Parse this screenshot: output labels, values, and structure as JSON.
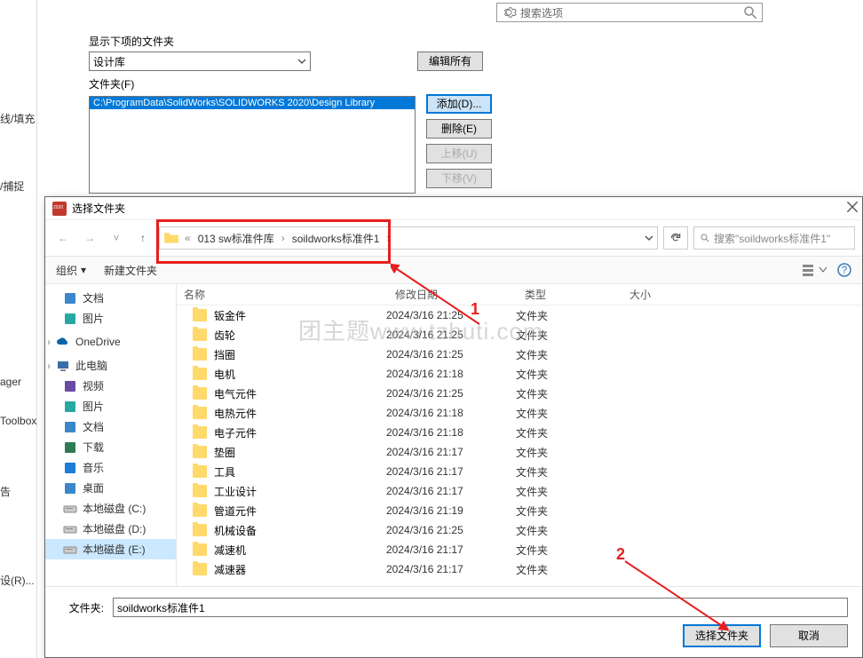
{
  "top_search": {
    "placeholder": "搜索选项"
  },
  "options": {
    "display_label": "显示下项的文件夹",
    "combo_value": "设计库",
    "edit_all": "编辑所有",
    "folders_label": "文件夹(F)",
    "add": "添加(D)...",
    "delete": "删除(E)",
    "move_up": "上移(U)",
    "move_down": "下移(V)",
    "path": "C:\\ProgramData\\SolidWorks\\SOLIDWORKS 2020\\Design Library"
  },
  "left_labels": {
    "l1": "线/填充",
    "l2": "ager",
    "l3": "/捕捉",
    "l4": "Toolbox",
    "l5": "告",
    "l6": "设(R)...",
    "l7": "OneDrive"
  },
  "dialog": {
    "title": "选择文件夹",
    "breadcrumb": {
      "sep_prefix": "«",
      "item1": "013 sw标准件库",
      "item2": "soildworks标准件1"
    },
    "search_placeholder": "搜索\"soildworks标准件1\"",
    "organize": "组织",
    "new_folder": "新建文件夹",
    "cols": {
      "name": "名称",
      "date": "修改日期",
      "type": "类型",
      "size": "大小"
    },
    "tree": [
      {
        "label": "文档",
        "kind": "doc"
      },
      {
        "label": "图片",
        "kind": "pic"
      },
      {
        "label": "OneDrive",
        "kind": "onedrive",
        "l0": true
      },
      {
        "label": "此电脑",
        "kind": "pc",
        "l0": true
      },
      {
        "label": "视频",
        "kind": "video"
      },
      {
        "label": "图片",
        "kind": "pic"
      },
      {
        "label": "文档",
        "kind": "doc"
      },
      {
        "label": "下载",
        "kind": "dl"
      },
      {
        "label": "音乐",
        "kind": "music"
      },
      {
        "label": "桌面",
        "kind": "desk"
      },
      {
        "label": "本地磁盘 (C:)",
        "kind": "disk"
      },
      {
        "label": "本地磁盘 (D:)",
        "kind": "disk"
      },
      {
        "label": "本地磁盘 (E:)",
        "kind": "disk",
        "sel": true
      }
    ],
    "rows": [
      {
        "name": "钣金件",
        "date": "2024/3/16 21:25",
        "type": "文件夹"
      },
      {
        "name": "齿轮",
        "date": "2024/3/16 21:25",
        "type": "文件夹"
      },
      {
        "name": "挡圈",
        "date": "2024/3/16 21:25",
        "type": "文件夹"
      },
      {
        "name": "电机",
        "date": "2024/3/16 21:18",
        "type": "文件夹"
      },
      {
        "name": "电气元件",
        "date": "2024/3/16 21:25",
        "type": "文件夹"
      },
      {
        "name": "电热元件",
        "date": "2024/3/16 21:18",
        "type": "文件夹"
      },
      {
        "name": "电子元件",
        "date": "2024/3/16 21:18",
        "type": "文件夹"
      },
      {
        "name": "垫圈",
        "date": "2024/3/16 21:17",
        "type": "文件夹"
      },
      {
        "name": "工具",
        "date": "2024/3/16 21:17",
        "type": "文件夹"
      },
      {
        "name": "工业设计",
        "date": "2024/3/16 21:17",
        "type": "文件夹"
      },
      {
        "name": "管道元件",
        "date": "2024/3/16 21:19",
        "type": "文件夹"
      },
      {
        "name": "机械设备",
        "date": "2024/3/16 21:25",
        "type": "文件夹"
      },
      {
        "name": "减速机",
        "date": "2024/3/16 21:17",
        "type": "文件夹"
      },
      {
        "name": "减速器",
        "date": "2024/3/16 21:17",
        "type": "文件夹"
      }
    ],
    "folder_label": "文件夹:",
    "folder_value": "soildworks标准件1",
    "ok": "选择文件夹",
    "cancel": "取消"
  },
  "annotations": {
    "n1": "1",
    "n2": "2"
  },
  "watermark": "团主题www.tzhuti.com"
}
